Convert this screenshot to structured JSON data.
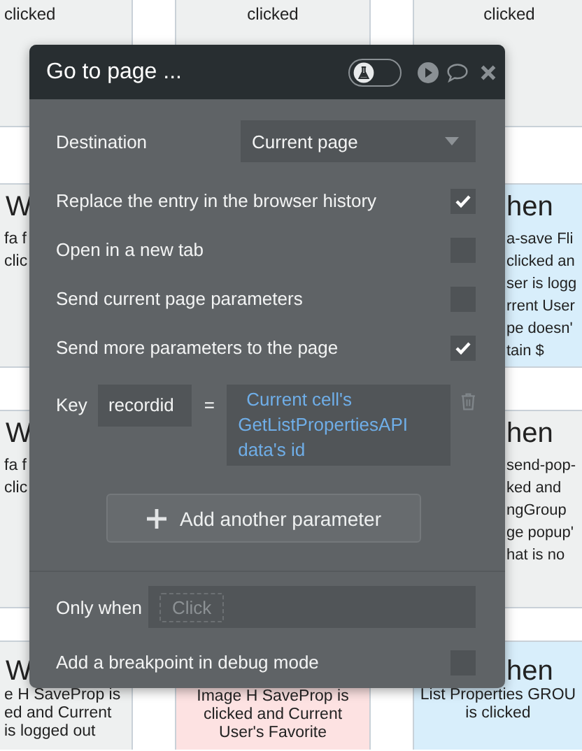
{
  "background_rows": [
    {
      "left": {
        "color": "#eef0f0",
        "lines": [
          "clicked"
        ]
      },
      "center": {
        "color": "#eef0f0",
        "lines": [
          "clicked"
        ]
      },
      "right": {
        "color": "#eef0f0",
        "lines": [
          "clicked"
        ]
      }
    },
    {
      "left": {
        "color": "#eef0f0",
        "heading": "W",
        "lines": [
          "fa f",
          "clic"
        ]
      },
      "right": {
        "color": "#d8eefb",
        "heading": "hen",
        "lines": [
          "a-save Fli",
          "clicked an",
          "ser is logg",
          "rrent User",
          "pe doesn'",
          "tain $"
        ]
      }
    },
    {
      "left": {
        "color": "#eef0f0",
        "heading": "W",
        "lines": [
          "fa f",
          "clic"
        ]
      },
      "right": {
        "color": "#eef0f0",
        "heading": "hen",
        "lines": [
          "send-pop-",
          "ked and",
          "ngGroup",
          "ge popup'",
          "hat is no"
        ]
      }
    },
    {
      "left": {
        "color": "#eef0f0",
        "heading": "W",
        "lines": [
          "e H SaveProp is",
          "ed and Current",
          "is logged out"
        ]
      },
      "center": {
        "color": "#fde2e2",
        "lines": [
          "Image H SaveProp is",
          "clicked and Current",
          "User's Favorite"
        ]
      },
      "right": {
        "color": "#d8eefb",
        "heading": "hen",
        "lines": [
          "List Properties GROU",
          "is clicked"
        ]
      }
    }
  ],
  "modal": {
    "title": "Go to page ...",
    "debug_toggle": {
      "on": false
    },
    "destination": {
      "label": "Destination",
      "value": "Current page"
    },
    "options": [
      {
        "label": "Replace the entry in the browser history",
        "checked": true
      },
      {
        "label": "Open in a new tab",
        "checked": false
      },
      {
        "label": "Send current page parameters",
        "checked": false
      },
      {
        "label": "Send more parameters to the page",
        "checked": true
      }
    ],
    "parameter": {
      "label": "Key",
      "key": "recordid",
      "operator": "=",
      "value": "Current cell's GetListPropertiesAPI data's id"
    },
    "add_button": "Add another parameter",
    "condition": {
      "label": "Only when",
      "placeholder": "Click"
    },
    "breakpoint": {
      "label": "Add a breakpoint in debug mode",
      "checked": false
    }
  }
}
